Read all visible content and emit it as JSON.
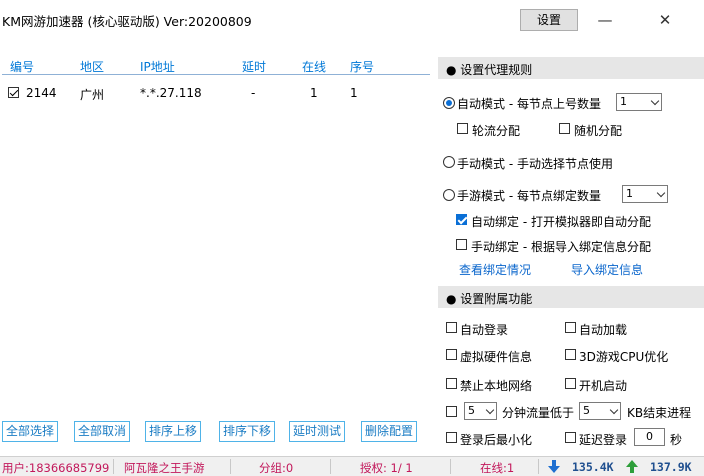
{
  "window": {
    "title": "KM网游加速器 (核心驱动版) Ver:20200809",
    "settings_label": "设置",
    "minimize_glyph": "—",
    "close_glyph": "✕"
  },
  "list": {
    "columns": [
      "编号",
      "地区",
      "IP地址",
      "延时",
      "在线",
      "序号"
    ],
    "rows": [
      {
        "checked": true,
        "id": "2144",
        "region": "广州",
        "ip": "*.*.27.118",
        "latency": "-",
        "online": "1",
        "seq": "1"
      }
    ]
  },
  "proxy_rules": {
    "header": "● 设置代理规则",
    "auto_mode": {
      "label": "自动模式 - 每节点上号数量",
      "selected": true,
      "count": "1"
    },
    "round_robin": {
      "label": "轮流分配",
      "checked": false
    },
    "random": {
      "label": "随机分配",
      "checked": false
    },
    "manual_mode": {
      "label": "手动模式 - 手动选择节点使用",
      "selected": false
    },
    "mobile_mode": {
      "label": "手游模式 - 每节点绑定数量",
      "selected": false,
      "count": "1"
    },
    "auto_bind": {
      "label": "自动绑定 - 打开模拟器即自动分配",
      "checked": true
    },
    "manual_bind": {
      "label": "手动绑定 - 根据导入绑定信息分配",
      "checked": false
    },
    "view_binding_link": "查看绑定情况",
    "import_binding_link": "导入绑定信息"
  },
  "extra": {
    "header": "● 设置附属功能",
    "auto_login": {
      "label": "自动登录",
      "checked": false
    },
    "auto_load": {
      "label": "自动加载",
      "checked": false
    },
    "virtual_hw": {
      "label": "虚拟硬件信息",
      "checked": false
    },
    "cpu_opt": {
      "label": "3D游戏CPU优化",
      "checked": false
    },
    "block_local": {
      "label": "禁止本地网络",
      "checked": false
    },
    "startup": {
      "label": "开机启动",
      "checked": false
    },
    "traffic_kill": {
      "checked": false,
      "minutes": "5",
      "label_mid": "分钟流量低于",
      "kb": "5",
      "label_end": "KB结束进程"
    },
    "minimize_after": {
      "label": "登录后最小化",
      "checked": false
    },
    "delay_login": {
      "label": "延迟登录",
      "checked": false,
      "value": "0",
      "unit": "秒"
    }
  },
  "buttons": {
    "select_all": "全部选择",
    "deselect_all": "全部取消",
    "sort_up": "排序上移",
    "sort_down": "排序下移",
    "latency_test": "延时测试",
    "delete_config": "删除配置"
  },
  "status": {
    "user": "用户:18366685799",
    "game": "阿瓦隆之王手游",
    "group": "分组:0",
    "auth": "授权: 1/ 1",
    "online": "在线:1",
    "down": "135.4K",
    "up": "137.9K",
    "colors": {
      "down_arrow": "#1e6fd0",
      "up_arrow": "#2e9e3a",
      "text": "#c2185b",
      "speed": "#1f4f8f"
    }
  }
}
